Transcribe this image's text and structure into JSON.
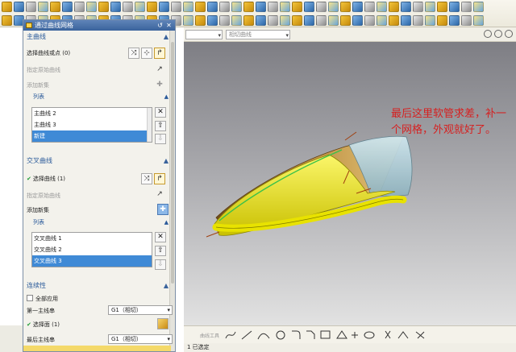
{
  "dialog": {
    "title": "通过曲线网格",
    "primary_section": {
      "header": "主曲线",
      "select_label": "选择曲线或点 (0)",
      "specify_origin": "指定原始曲线",
      "add_new_set": "添加新集",
      "list_header": "列表",
      "items": [
        "主曲线 2",
        "主曲线 3",
        "新建"
      ],
      "selected_index": 2
    },
    "cross_section": {
      "header": "交叉曲线",
      "select_label": "选择曲线 (1)",
      "specify_origin": "指定原始曲线",
      "add_new_set": "添加新集",
      "list_header": "列表",
      "items": [
        "交叉曲线 1",
        "交叉曲线 2",
        "交叉曲线 3"
      ],
      "selected_index": 2
    },
    "continuity": {
      "header": "连续性",
      "apply_all": "全部应用",
      "first_primary_label": "第一主线串",
      "first_primary_value": "G1（相切）",
      "select_face": "选择面 (1)",
      "last_primary_label": "最后主线串",
      "last_primary_value": "G1（相切）"
    }
  },
  "toolbar2": {
    "combo1": "",
    "combo2": "相切曲线"
  },
  "annotation": "最后这里软管求差，补一个网格，外观就好了。",
  "bottom_toolbar": {
    "label": "曲线工具"
  },
  "status": {
    "text": "1 已选定"
  },
  "colors": {
    "selection_blue": "#3f8ad6",
    "title_bar": "#4a73ab",
    "annotation_red": "#d62020",
    "model_yellow": "#f2ec1c"
  }
}
